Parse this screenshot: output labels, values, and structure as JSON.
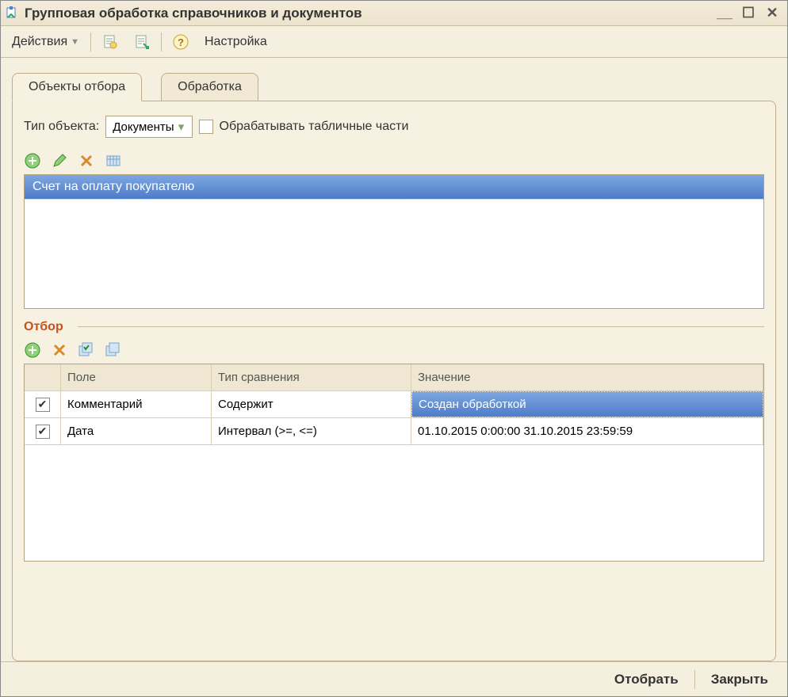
{
  "window": {
    "title": "Групповая обработка справочников и документов"
  },
  "toolbar": {
    "actions_label": "Действия",
    "settings_label": "Настройка"
  },
  "tabs": {
    "selection": "Объекты отбора",
    "processing": "Обработка"
  },
  "objectType": {
    "label": "Тип объекта:",
    "value": "Документы",
    "processTabularLabel": "Обрабатывать табличные части"
  },
  "objectsList": {
    "items": [
      "Счет на оплату покупателю"
    ]
  },
  "filter": {
    "title": "Отбор",
    "columns": {
      "field": "Поле",
      "comparison": "Тип сравнения",
      "value": "Значение"
    },
    "rows": [
      {
        "checked": true,
        "field": "Комментарий",
        "comparison": "Содержит",
        "value": "Создан обработкой",
        "selected": true
      },
      {
        "checked": true,
        "field": "Дата",
        "comparison": "Интервал (>=, <=)",
        "value": "01.10.2015 0:00:00      31.10.2015 23:59:59",
        "selected": false
      }
    ]
  },
  "footer": {
    "select": "Отобрать",
    "close": "Закрыть"
  },
  "icons": {
    "add": "add-icon",
    "edit": "edit-icon",
    "delete": "delete-icon",
    "props": "props-icon",
    "checkall": "checkall-icon",
    "uncheckall": "uncheckall-icon",
    "help": "help-icon",
    "doc1": "doc1-icon",
    "doc2": "doc2-icon"
  }
}
